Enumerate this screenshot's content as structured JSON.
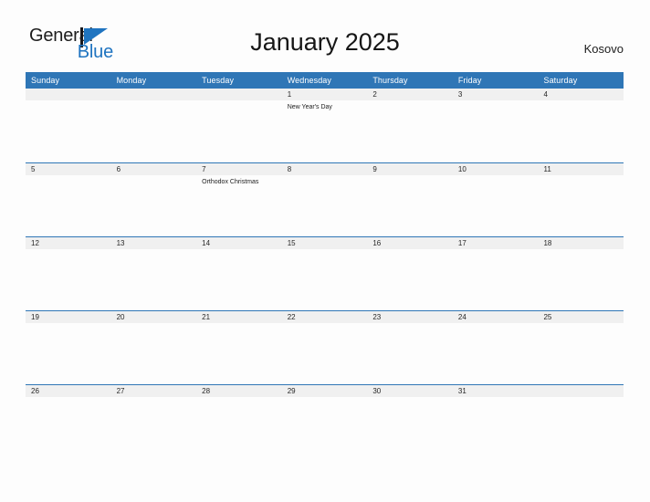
{
  "brand": {
    "name_part1": "General",
    "name_part2": "Blue",
    "flag_icon": "blue-triangle-flag-icon",
    "dark_color": "#1d1d1d",
    "blue_color": "#1f74c0"
  },
  "header": {
    "title": "January 2025",
    "region": "Kosovo"
  },
  "theme": {
    "header_blue": "#2f76b6",
    "row_band_gray": "#f0f0f0",
    "page_background": "#fdfdfd",
    "text_color": "#1a1a1a"
  },
  "calendar": {
    "month": "January",
    "year": "2025",
    "weekday_headers": [
      "Sunday",
      "Monday",
      "Tuesday",
      "Wednesday",
      "Thursday",
      "Friday",
      "Saturday"
    ],
    "weeks": [
      [
        {
          "num": "",
          "events": []
        },
        {
          "num": "",
          "events": []
        },
        {
          "num": "",
          "events": []
        },
        {
          "num": "1",
          "events": [
            "New Year's Day"
          ]
        },
        {
          "num": "2",
          "events": []
        },
        {
          "num": "3",
          "events": []
        },
        {
          "num": "4",
          "events": []
        }
      ],
      [
        {
          "num": "5",
          "events": []
        },
        {
          "num": "6",
          "events": []
        },
        {
          "num": "7",
          "events": [
            "Orthodox Christmas"
          ]
        },
        {
          "num": "8",
          "events": []
        },
        {
          "num": "9",
          "events": []
        },
        {
          "num": "10",
          "events": []
        },
        {
          "num": "11",
          "events": []
        }
      ],
      [
        {
          "num": "12",
          "events": []
        },
        {
          "num": "13",
          "events": []
        },
        {
          "num": "14",
          "events": []
        },
        {
          "num": "15",
          "events": []
        },
        {
          "num": "16",
          "events": []
        },
        {
          "num": "17",
          "events": []
        },
        {
          "num": "18",
          "events": []
        }
      ],
      [
        {
          "num": "19",
          "events": []
        },
        {
          "num": "20",
          "events": []
        },
        {
          "num": "21",
          "events": []
        },
        {
          "num": "22",
          "events": []
        },
        {
          "num": "23",
          "events": []
        },
        {
          "num": "24",
          "events": []
        },
        {
          "num": "25",
          "events": []
        }
      ],
      [
        {
          "num": "26",
          "events": []
        },
        {
          "num": "27",
          "events": []
        },
        {
          "num": "28",
          "events": []
        },
        {
          "num": "29",
          "events": []
        },
        {
          "num": "30",
          "events": []
        },
        {
          "num": "31",
          "events": []
        },
        {
          "num": "",
          "events": []
        }
      ]
    ]
  }
}
